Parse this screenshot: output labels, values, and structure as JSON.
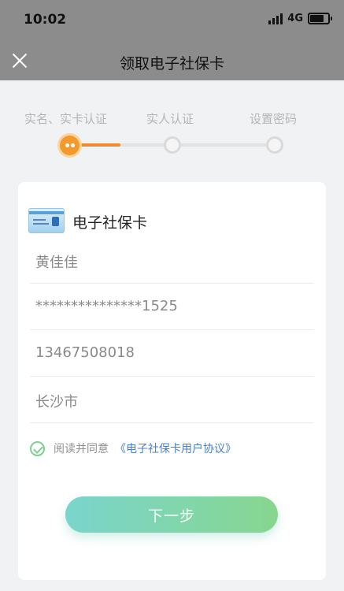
{
  "status_bar": {
    "time": "10:02",
    "network": "4G"
  },
  "nav": {
    "title": "领取电子社保卡"
  },
  "steps": [
    {
      "label": "实名、实卡认证",
      "state": "active"
    },
    {
      "label": "实人认证",
      "state": "pending"
    },
    {
      "label": "设置密码",
      "state": "pending"
    }
  ],
  "card": {
    "title": "电子社保卡",
    "fields": [
      {
        "name": "name",
        "value": "黄佳佳"
      },
      {
        "name": "id_number",
        "value": "***************1525"
      },
      {
        "name": "phone",
        "value": "13467508018"
      },
      {
        "name": "city",
        "value": "长沙市"
      }
    ]
  },
  "agreement": {
    "checked": true,
    "text": "阅读并同意",
    "link": "《电子社保卡用户协议》"
  },
  "next_button": {
    "label": "下一步"
  },
  "colors": {
    "header_bg": "#8c8c8c",
    "step_active": "#f39a2c",
    "link": "#4a7fc1",
    "button_gradient_start": "#7ad5cc",
    "button_gradient_end": "#87d68f",
    "check": "#7ccf8f"
  },
  "icons": [
    "close-icon",
    "signal-icon",
    "battery-icon",
    "social-security-card-icon",
    "check-circle-icon"
  ]
}
